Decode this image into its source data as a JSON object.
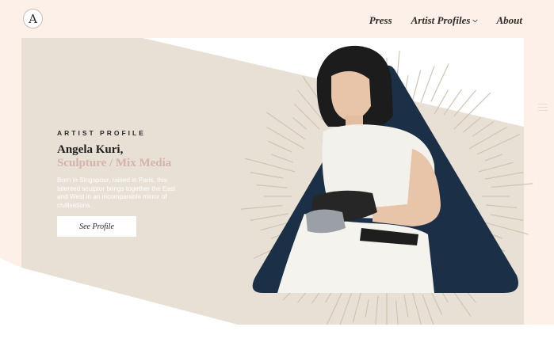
{
  "header": {
    "logo_letter": "A",
    "nav": [
      {
        "label": "Press"
      },
      {
        "label": "Artist Profiles"
      },
      {
        "label": "About"
      }
    ]
  },
  "hero": {
    "eyebrow": "ARTIST PROFILE",
    "name": "Angela Kuri,",
    "role": "Sculpture / Mix Media",
    "bio": "Born in Singapour, raised in Paris, this talented sculptor brings together the East and West in an incomparable mirror of civilisations.",
    "cta_label": "See Profile"
  },
  "colors": {
    "page_bg": "#fdf0e8",
    "panel_beige": "#e8e0d4",
    "triangle_navy": "#1b3047",
    "role_pink": "#d4b3ad"
  }
}
